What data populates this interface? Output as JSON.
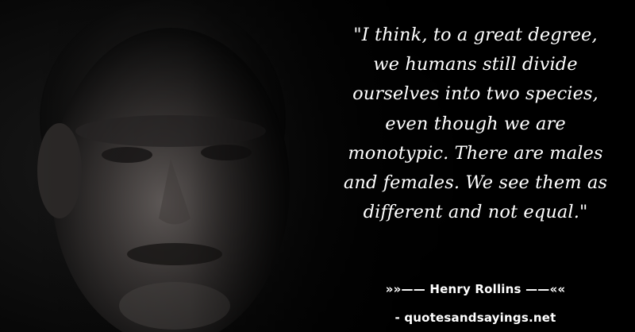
{
  "quote": {
    "lines": [
      "\"I think, to a great degree,",
      "we humans still divide",
      "ourselves into two species,",
      "even though we are",
      "monotypic. There are males",
      "and females. We see them as",
      "different and not equal.\""
    ]
  },
  "attribution": {
    "text": "»»—— Henry Rollins ——««"
  },
  "source": {
    "text": "- quotesandsayings.net"
  },
  "colors": {
    "background": "#000000",
    "text": "#ffffff"
  }
}
